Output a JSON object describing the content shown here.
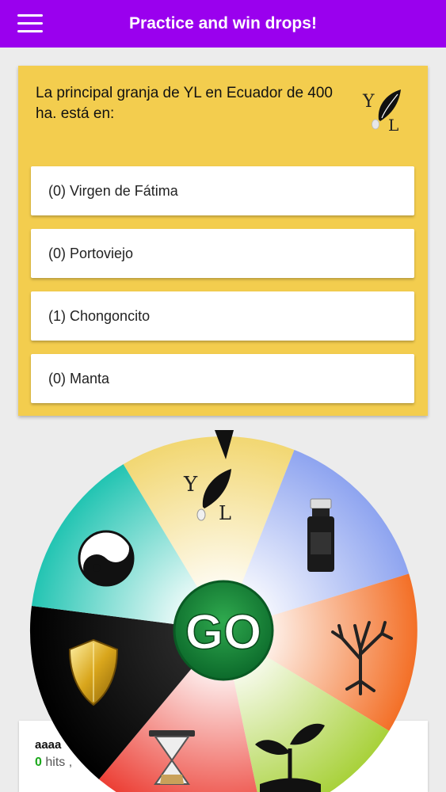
{
  "header": {
    "title": "Practice and win drops!",
    "menu_icon": "hamburger-menu-icon"
  },
  "question": {
    "text": "La principal granja de YL en Ecuador de 400 ha. está en:",
    "logo_text_y": "Y",
    "logo_text_l": "L",
    "answers": [
      {
        "label": "(0) Virgen de Fátima"
      },
      {
        "label": "(0) Portoviejo"
      },
      {
        "label": "(1) Chongoncito"
      },
      {
        "label": "(0) Manta"
      }
    ]
  },
  "wheel": {
    "go_label": "GO",
    "segments": [
      {
        "icon": "young-living-logo-icon",
        "color": "#f3e6a6"
      },
      {
        "icon": "oil-bottle-icon",
        "color": "#aebdf2"
      },
      {
        "icon": "tree-icon",
        "color": "#f6a66a"
      },
      {
        "icon": "sprout-icon",
        "color": "#c7e07a"
      },
      {
        "icon": "hourglass-icon",
        "color": "#f08a7e"
      },
      {
        "icon": "shield-icon",
        "color": "#111111"
      },
      {
        "icon": "yin-yang-icon",
        "color": "#7fd8cf"
      }
    ]
  },
  "footer": {
    "name": "aaaa",
    "hits_count": "0",
    "hits_label": "hits ,"
  }
}
